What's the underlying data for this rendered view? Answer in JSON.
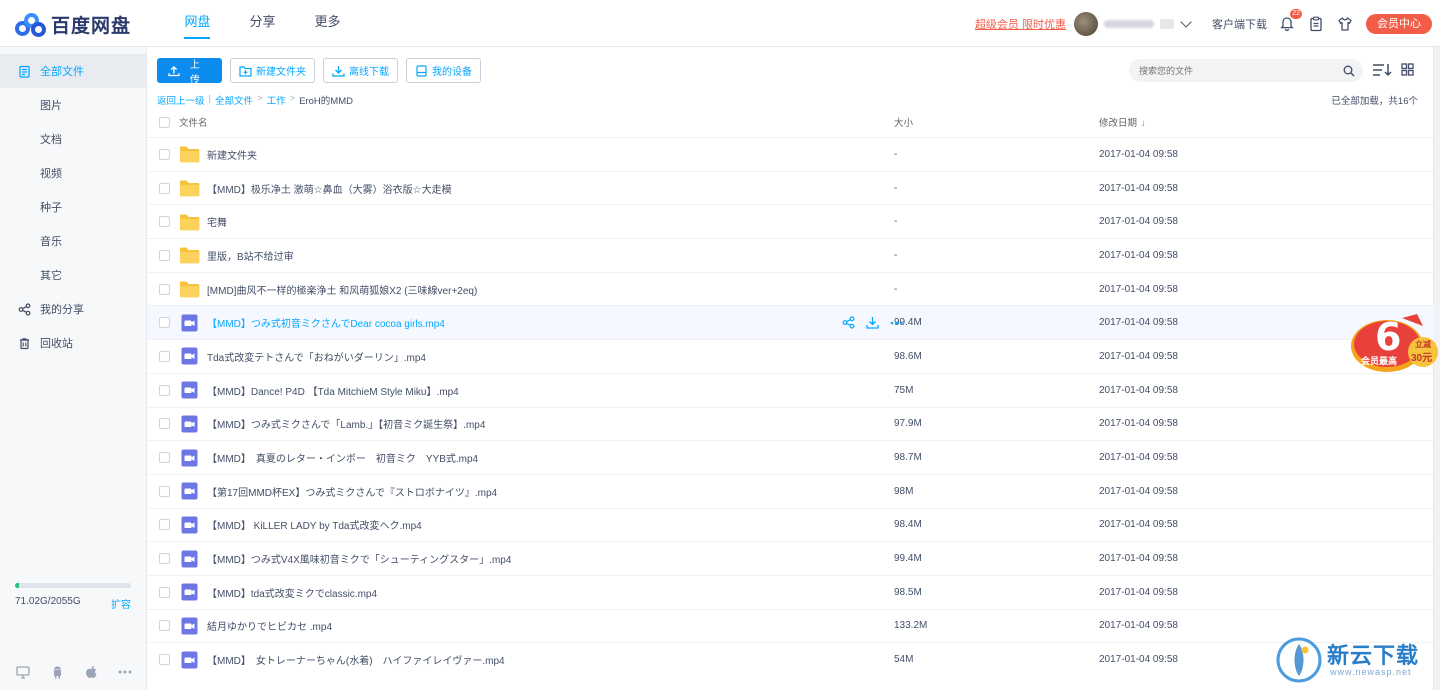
{
  "header": {
    "logo_text": "百度网盘",
    "nav": [
      {
        "label": "网盘",
        "active": true
      },
      {
        "label": "分享",
        "active": false
      },
      {
        "label": "更多",
        "active": false
      }
    ],
    "promo_link": "超级会员 限时优惠",
    "client_download": "客户端下载",
    "notification_count": "22",
    "vip_center": "会员中心"
  },
  "sidebar": {
    "items": [
      {
        "label": "全部文件",
        "icon": "all-files-icon",
        "active": true,
        "sub": false
      },
      {
        "label": "图片",
        "sub": true
      },
      {
        "label": "文档",
        "sub": true
      },
      {
        "label": "视频",
        "sub": true
      },
      {
        "label": "种子",
        "sub": true
      },
      {
        "label": "音乐",
        "sub": true
      },
      {
        "label": "其它",
        "sub": true
      },
      {
        "label": "我的分享",
        "icon": "share-icon",
        "sub": false
      },
      {
        "label": "回收站",
        "icon": "trash-icon",
        "sub": false
      }
    ],
    "quota": {
      "text": "71.02G/2055G",
      "used_fraction": 0.035,
      "expand": "扩容"
    }
  },
  "toolbar": {
    "upload": "上传",
    "new_folder": "新建文件夹",
    "offline_download": "离线下载",
    "my_devices": "我的设备",
    "search_placeholder": "搜索您的文件"
  },
  "breadcrumb": {
    "back": "返回上一级",
    "all_files": "全部文件",
    "folder1": "工作",
    "current": "EroH的MMD",
    "sep": ">",
    "divider": "|"
  },
  "load_status": "已全部加载，共16个",
  "table": {
    "columns": {
      "name": "文件名",
      "size": "大小",
      "date": "修改日期"
    },
    "rows": [
      {
        "type": "folder",
        "name": "新建文件夹",
        "size": "-",
        "date": "2017-01-04 09:58"
      },
      {
        "type": "folder",
        "name": "【MMD】极乐净土 激萌☆鼻血（大雾）浴衣版☆大走模",
        "size": "-",
        "date": "2017-01-04 09:58"
      },
      {
        "type": "folder",
        "name": "宅舞",
        "size": "-",
        "date": "2017-01-04 09:58"
      },
      {
        "type": "folder",
        "name": "里版，B站不给过审",
        "size": "-",
        "date": "2017-01-04 09:58"
      },
      {
        "type": "folder",
        "name": "[MMD]曲风不一样的極楽浄土 和风萌狐娘X2 (三味線ver+2eq)",
        "size": "-",
        "date": "2017-01-04 09:58"
      },
      {
        "type": "video",
        "name": "【MMD】つみ式初音ミクさんでDear cocoa girls.mp4",
        "size": "99.4M",
        "date": "2017-01-04 09:58",
        "hover": true
      },
      {
        "type": "video",
        "name": "Tda式改変テトさんで「おねがいダーリン」.mp4",
        "size": "98.6M",
        "date": "2017-01-04 09:58"
      },
      {
        "type": "video",
        "name": "【MMD】Dance! P4D 【Tda MitchieM Style Miku】.mp4",
        "size": "75M",
        "date": "2017-01-04 09:58"
      },
      {
        "type": "video",
        "name": "【MMD】つみ式ミクさんで「Lamb.」【初音ミク誕生祭】.mp4",
        "size": "97.9M",
        "date": "2017-01-04 09:58"
      },
      {
        "type": "video",
        "name": "【MMD】　真夏のレター・インボー　初音ミク　YYB式.mp4",
        "size": "98.7M",
        "date": "2017-01-04 09:58"
      },
      {
        "type": "video",
        "name": "【第17回MMD杯EX】つみ式ミクさんで『ストロボナイツ』.mp4",
        "size": "98M",
        "date": "2017-01-04 09:58"
      },
      {
        "type": "video",
        "name": "【MMD】 KiLLER LADY by Tda式改変ヘク.mp4",
        "size": "98.4M",
        "date": "2017-01-04 09:58"
      },
      {
        "type": "video",
        "name": "【MMD】つみ式V4X風味初音ミクで「シューティングスター」.mp4",
        "size": "99.4M",
        "date": "2017-01-04 09:58"
      },
      {
        "type": "video",
        "name": "【MMD】tda式改変ミクでclassic.mp4",
        "size": "98.5M",
        "date": "2017-01-04 09:58"
      },
      {
        "type": "video",
        "name": "結月ゆかりでヒビカセ .mp4",
        "size": "133.2M",
        "date": "2017-01-04 09:58"
      },
      {
        "type": "video",
        "name": "【MMD】　女トレーナーちゃん(水着)　ハイファイレイヴァー.mp4",
        "size": "54M",
        "date": "2017-01-04 09:58"
      }
    ]
  },
  "promo_badge": {
    "line1": "会员最高",
    "line2": "立减",
    "line3": "30元"
  },
  "watermark": {
    "text": "新云下载",
    "url": "www.newasp.net"
  },
  "colors": {
    "accent": "#06a7ff",
    "primary_button": "#0d8cf0",
    "promo_red": "#f25d48",
    "folder": "#f7c33c",
    "video": "#6c76e4"
  }
}
